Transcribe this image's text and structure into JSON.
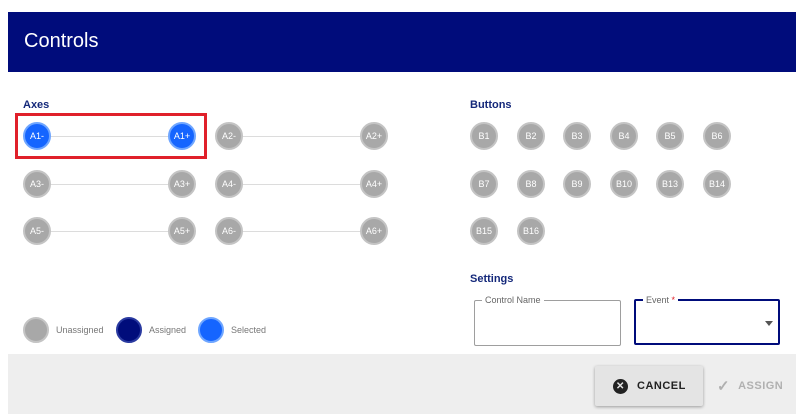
{
  "header": {
    "title": "Controls"
  },
  "axes": {
    "label": "Axes",
    "buttons": [
      "A1-",
      "A1+",
      "A2-",
      "A2+",
      "A3-",
      "A3+",
      "A4-",
      "A4+",
      "A5-",
      "A5+",
      "A6-",
      "A6+"
    ],
    "selected": [
      "A1-",
      "A1+"
    ]
  },
  "buttons_section": {
    "label": "Buttons",
    "buttons": [
      "B1",
      "B2",
      "B3",
      "B4",
      "B5",
      "B6",
      "B7",
      "B8",
      "B9",
      "B10",
      "B13",
      "B14",
      "B15",
      "B16"
    ]
  },
  "legend": {
    "unassigned": "Unassigned",
    "assigned": "Assigned",
    "selected": "Selected"
  },
  "settings": {
    "label": "Settings",
    "control_name_label": "Control Name",
    "control_name_value": "",
    "event_label": "Event",
    "event_required_mark": "*",
    "event_value": ""
  },
  "footer": {
    "cancel_label": "CANCEL",
    "assign_label": "ASSIGN"
  },
  "colors": {
    "header_bg": "#000c7b",
    "unassigned": "#a8a8a8",
    "assigned": "#000c7b",
    "selected": "#1565ff",
    "highlight": "#e0202a"
  }
}
